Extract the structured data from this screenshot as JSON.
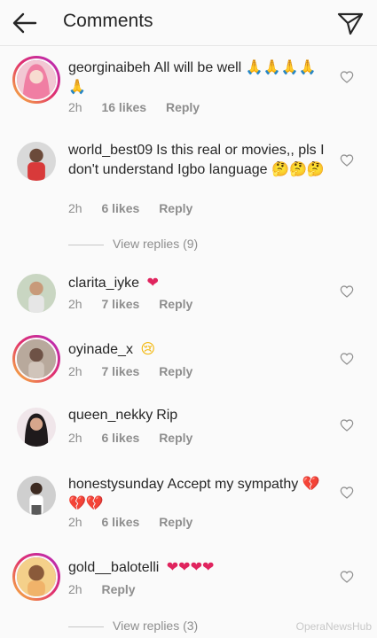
{
  "header": {
    "title": "Comments",
    "back_icon": "arrow-left-icon",
    "send_icon": "paper-plane-icon"
  },
  "comments": [
    {
      "username": "georginaibeh",
      "text": "All will be well",
      "emoji": "🙏🙏🙏🙏🙏",
      "time": "2h",
      "likes": "16 likes",
      "reply": "Reply",
      "story_ring": true
    },
    {
      "username": "world_best09",
      "text": "Is this real or movies,, pls I don't understand Igbo language",
      "emoji": "🤔🤔🤔",
      "time": "2h",
      "likes": "6 likes",
      "reply": "Reply",
      "story_ring": false
    },
    {
      "username": "clarita_iyke",
      "text": "",
      "emoji": "❤",
      "time": "2h",
      "likes": "7 likes",
      "reply": "Reply",
      "story_ring": false
    },
    {
      "username": "oyinade_x",
      "text": "",
      "emoji": "😢",
      "time": "2h",
      "likes": "7 likes",
      "reply": "Reply",
      "story_ring": true
    },
    {
      "username": "queen_nekky",
      "text": "Rip",
      "emoji": "",
      "time": "2h",
      "likes": "6 likes",
      "reply": "Reply",
      "story_ring": false
    },
    {
      "username": "honestysunday",
      "text": "Accept my sympathy",
      "emoji": "💔💔💔",
      "time": "2h",
      "likes": "6 likes",
      "reply": "Reply",
      "story_ring": false
    },
    {
      "username": "gold__balotelli",
      "text": "",
      "emoji": "❤❤❤❤",
      "time": "2h",
      "likes": "",
      "reply": "Reply",
      "story_ring": true
    }
  ],
  "view_replies": [
    "View replies (9)",
    "View replies (3)"
  ],
  "watermark": "OperaNewsHub"
}
